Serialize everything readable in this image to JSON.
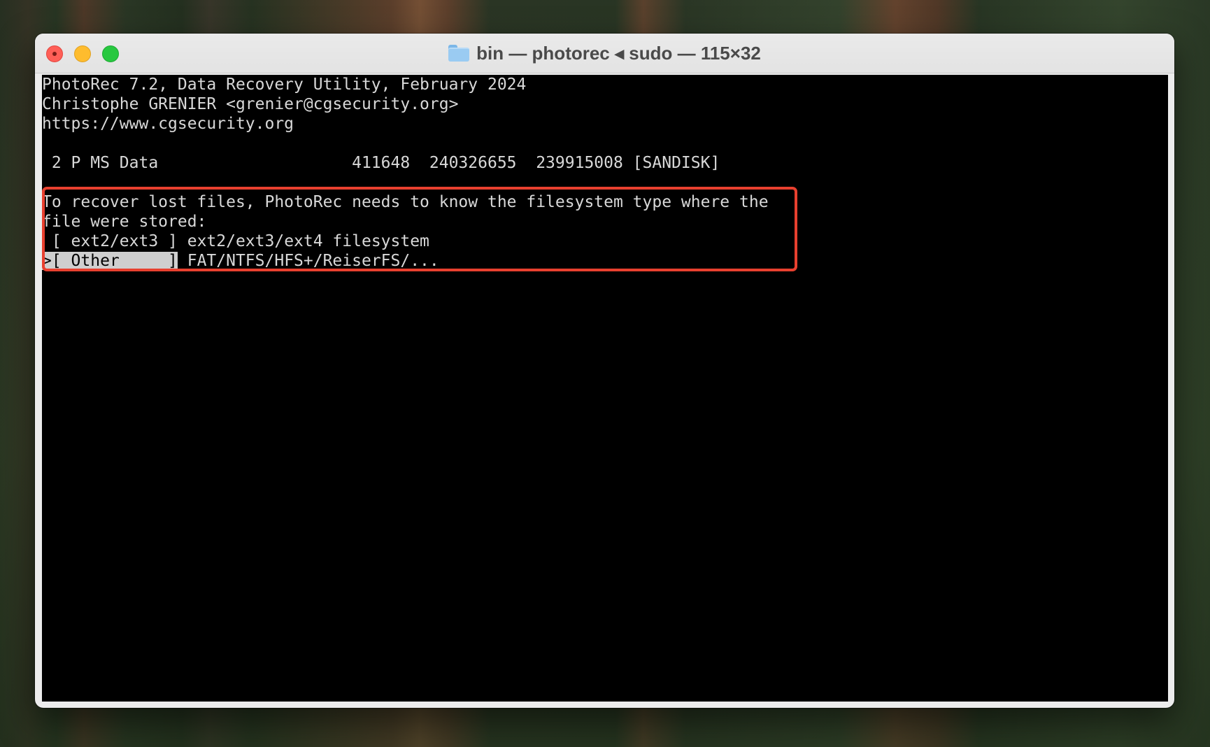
{
  "window": {
    "title": "bin — photorec ◂ sudo — 115×32"
  },
  "terminal": {
    "header_line_1": "PhotoRec 7.2, Data Recovery Utility, February 2024",
    "header_line_2": "Christophe GRENIER <grenier@cgsecurity.org>",
    "header_line_3": "https://www.cgsecurity.org",
    "partition": {
      "line": " 2 P MS Data                    411648  240326655  239915008 [SANDISK]"
    },
    "prompt_line_1": "To recover lost files, PhotoRec needs to know the filesystem type where the",
    "prompt_line_2": "file were stored:",
    "options": [
      {
        "prefix": " ",
        "label": "[ ext2/ext3 ]",
        "description": " ext2/ext3/ext4 filesystem",
        "selected": false
      },
      {
        "prefix": ">",
        "label": "[ Other     ]",
        "description": " FAT/NTFS/HFS+/ReiserFS/...",
        "selected": true
      }
    ]
  },
  "colors": {
    "highlight_box": "#e8402f",
    "terminal_bg": "#000000",
    "terminal_fg": "#d8d8d8",
    "selection_bg": "#cfcfcf"
  },
  "icons": {
    "title_icon": "folder-icon"
  }
}
